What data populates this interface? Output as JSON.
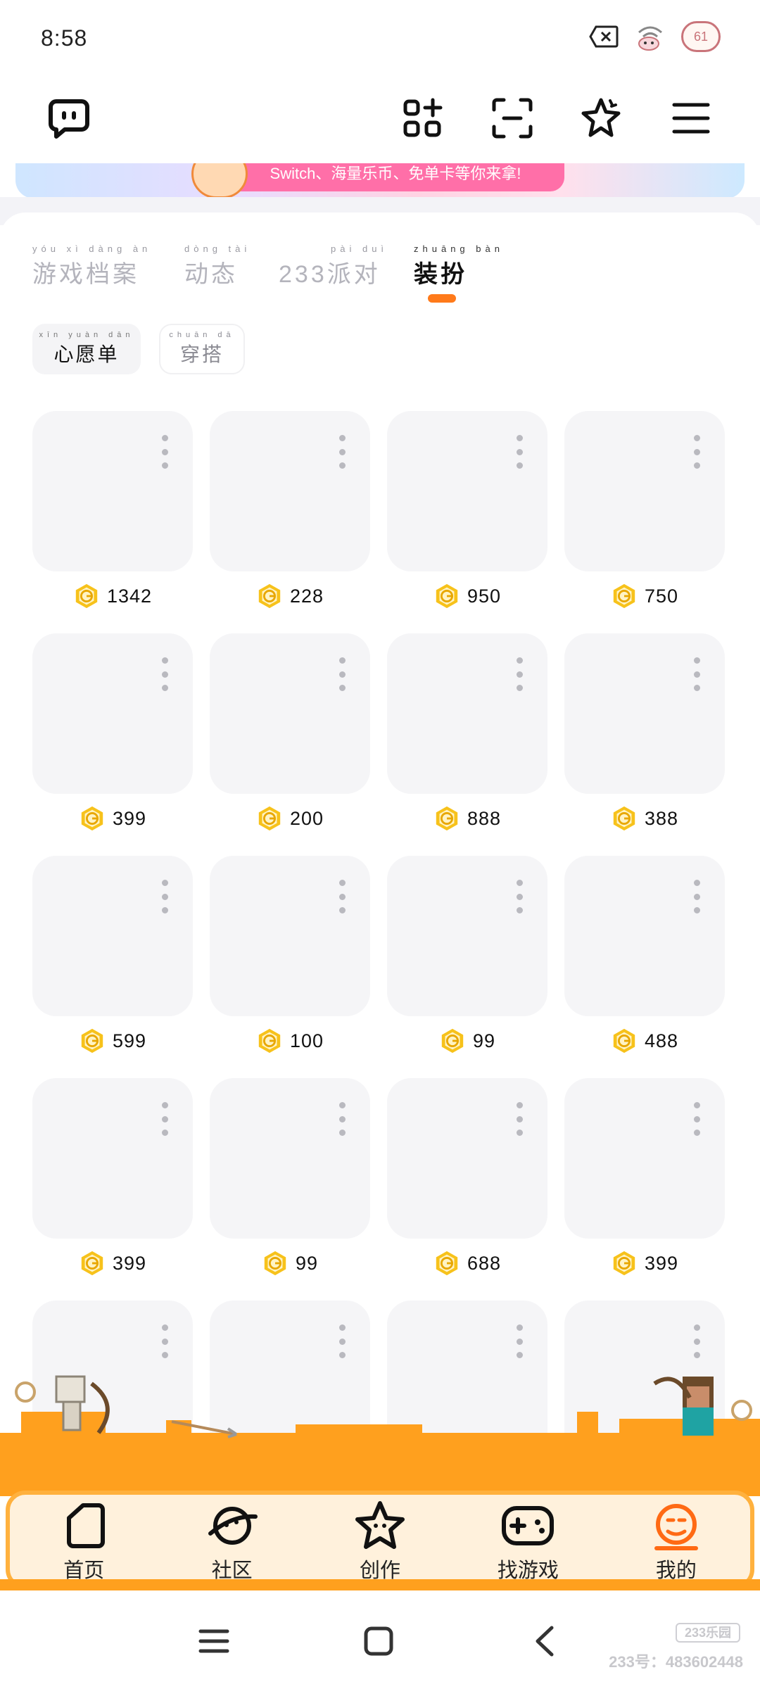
{
  "status_bar": {
    "time": "8:58",
    "battery_badge": "61",
    "icons": [
      "close-box-icon",
      "wifi-icon",
      "pig-avatar-icon"
    ]
  },
  "toolbar": {
    "icons": [
      "chat-bubble-icon",
      "apps-grid-icon",
      "scan-icon",
      "star-sparkle-icon",
      "menu-icon"
    ]
  },
  "banner": {
    "text": "Switch、海量乐币、免单卡等你来拿!"
  },
  "tabs": [
    {
      "pinyin": "yóu xì dàng àn",
      "label": "游戏档案"
    },
    {
      "pinyin": "dòng tài",
      "label": "动态"
    },
    {
      "pinyin": "pài duì",
      "label": "233派对"
    },
    {
      "pinyin": "zhuāng bàn",
      "label": "装扮",
      "active": true
    }
  ],
  "chips": [
    {
      "pinyin": "xīn yuàn dān",
      "label": "心愿单",
      "selected": true
    },
    {
      "pinyin": "chuān dā",
      "label": "穿搭",
      "selected": false
    }
  ],
  "items": [
    {
      "price": "1342"
    },
    {
      "price": "228"
    },
    {
      "price": "950"
    },
    {
      "price": "750"
    },
    {
      "price": "399"
    },
    {
      "price": "200"
    },
    {
      "price": "888"
    },
    {
      "price": "388"
    },
    {
      "price": "599"
    },
    {
      "price": "100"
    },
    {
      "price": "99"
    },
    {
      "price": "488"
    },
    {
      "price": "399"
    },
    {
      "price": "99"
    },
    {
      "price": "688"
    },
    {
      "price": "399"
    },
    {
      "price": ""
    },
    {
      "price": ""
    },
    {
      "price": ""
    },
    {
      "price": ""
    }
  ],
  "bottom_nav": [
    {
      "label": "首页",
      "icon": "home-icon"
    },
    {
      "label": "社区",
      "icon": "planet-icon"
    },
    {
      "label": "创作",
      "icon": "star-face-icon"
    },
    {
      "label": "找游戏",
      "icon": "gamepad-icon"
    },
    {
      "label": "我的",
      "icon": "profile-face-icon",
      "active": true
    }
  ],
  "watermark": {
    "logo": "233乐园",
    "id_text": "233号：483602448"
  },
  "colors": {
    "accent": "#ff7a1a",
    "coin": "#f7c21b",
    "nav_bg": "#fff1dc",
    "nav_border": "#ffb13e",
    "thumb_bg": "#f5f5f7"
  }
}
